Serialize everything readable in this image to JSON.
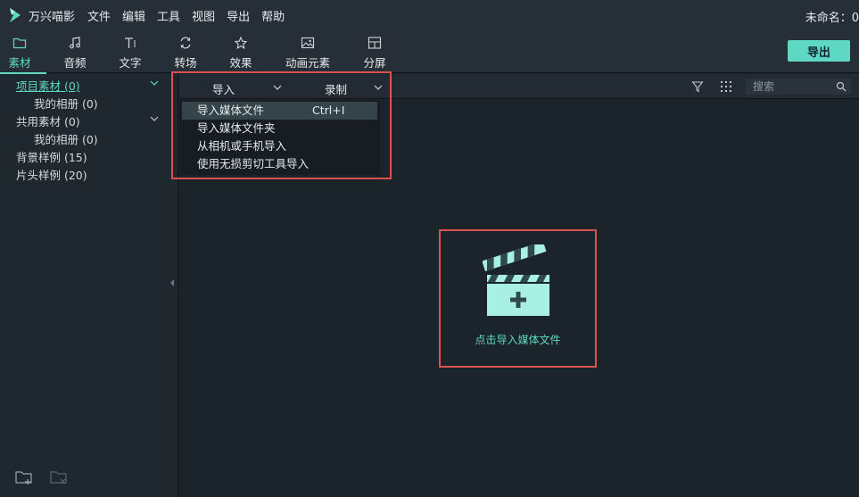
{
  "app": {
    "name": "万兴喵影",
    "document_title": "未命名：0",
    "accent_color": "#5ed8c2",
    "highlight_color": "#d9534c"
  },
  "menu": {
    "items": [
      "文件",
      "编辑",
      "工具",
      "视图",
      "导出",
      "帮助"
    ]
  },
  "toolbar": {
    "tabs": [
      {
        "label": "素材",
        "icon": "folder-icon"
      },
      {
        "label": "音频",
        "icon": "music-note-icon"
      },
      {
        "label": "文字",
        "icon": "text-icon"
      },
      {
        "label": "转场",
        "icon": "transition-icon"
      },
      {
        "label": "效果",
        "icon": "effects-star-icon"
      },
      {
        "label": "动画元素",
        "icon": "image-icon"
      },
      {
        "label": "分屏",
        "icon": "split-screen-icon"
      }
    ],
    "export_label": "导出"
  },
  "sidebar": {
    "items": [
      {
        "label": "项目素材 (0)"
      },
      {
        "label": "我的相册 (0)"
      },
      {
        "label": "共用素材 (0)"
      },
      {
        "label": "我的相册 (0)"
      },
      {
        "label": "背景样例 (15)"
      },
      {
        "label": "片头样例 (20)"
      }
    ]
  },
  "content": {
    "import_label": "导入",
    "record_label": "录制",
    "search_placeholder": "搜索",
    "empty_label": "点击导入媒体文件"
  },
  "import_menu": {
    "items": [
      {
        "label": "导入媒体文件",
        "shortcut": "Ctrl+I"
      },
      {
        "label": "导入媒体文件夹"
      },
      {
        "label": "从相机或手机导入"
      },
      {
        "label": "使用无损剪切工具导入"
      }
    ]
  }
}
